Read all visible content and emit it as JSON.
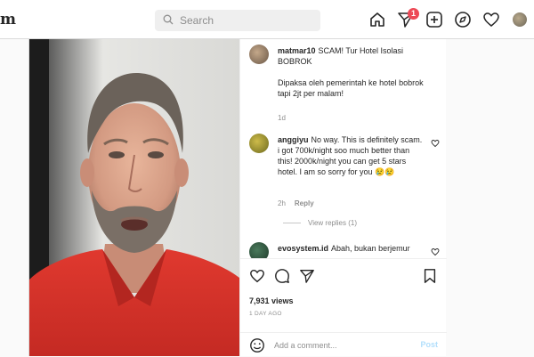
{
  "header": {
    "logo_text": "m",
    "search_placeholder": "Search",
    "notification_count": "1",
    "icons": [
      "home-icon",
      "direct-icon",
      "new-post-icon",
      "explore-icon",
      "activity-icon",
      "profile-avatar"
    ]
  },
  "comments": [
    {
      "user": "matmar10",
      "text": "SCAM! Tur Hotel Isolasi BOBROK",
      "text2": "Dipaksa oleh pemerintah ke hotel bobrok tapi 2jt per malam!",
      "meta": "1d"
    },
    {
      "user": "anggiyu",
      "text": "No way. This is definitely scam. i got 700k/night soo much better than this! 2000k/night you can get 5 stars hotel. I am so sorry for you 😢😢",
      "meta_time": "2h",
      "meta_reply": "Reply",
      "view_replies": "View replies (1)"
    },
    {
      "user": "evosystem.id",
      "text": "Abah, bukan berjemur"
    }
  ],
  "post": {
    "likes_text": "7,931 views",
    "time_text": "1 DAY AGO",
    "comment_placeholder": "Add a comment...",
    "post_label": "Post"
  },
  "colors": {
    "badge": "#ed4956",
    "post_button": "#b2dffc",
    "shirt": "#d8312b"
  }
}
